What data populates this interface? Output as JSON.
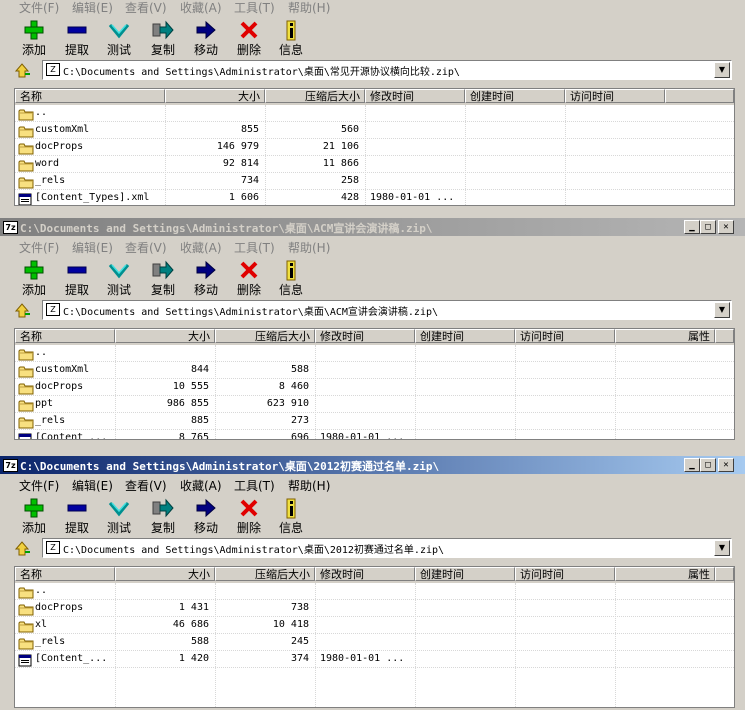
{
  "menu": [
    {
      "label": "文件(F)"
    },
    {
      "label": "编辑(E)"
    },
    {
      "label": "查看(V)"
    },
    {
      "label": "收藏(A)"
    },
    {
      "label": "工具(T)"
    },
    {
      "label": "帮助(H)"
    }
  ],
  "toolbar": [
    {
      "label": "添加",
      "icon": "add-icon"
    },
    {
      "label": "提取",
      "icon": "extract-icon"
    },
    {
      "label": "测试",
      "icon": "test-icon"
    },
    {
      "label": "复制",
      "icon": "copy-icon"
    },
    {
      "label": "移动",
      "icon": "move-icon"
    },
    {
      "label": "删除",
      "icon": "delete-icon"
    },
    {
      "label": "信息",
      "icon": "info-icon"
    }
  ],
  "colors": {
    "title_active": "#0a246a",
    "title_inactive": "#808080",
    "add": "#00c000",
    "extract": "#0000a0",
    "delete": "#e00000",
    "info": "#e0c000"
  },
  "windows": [
    {
      "title": "",
      "address": "C:\\Documents and Settings\\Administrator\\桌面\\常见开源协议横向比较.zip\\",
      "columns": [
        "名称",
        "大小",
        "压缩后大小",
        "修改时间",
        "创建时间",
        "访问时间"
      ],
      "files": [
        {
          "name": "..",
          "size": "",
          "packed": "",
          "modified": ""
        },
        {
          "name": "customXml",
          "size": "855",
          "packed": "560",
          "modified": ""
        },
        {
          "name": "docProps",
          "size": "146 979",
          "packed": "21 106",
          "modified": ""
        },
        {
          "name": "word",
          "size": "92 814",
          "packed": "11 866",
          "modified": ""
        },
        {
          "name": "_rels",
          "size": "734",
          "packed": "258",
          "modified": ""
        },
        {
          "name": "[Content_Types].xml",
          "size": "1 606",
          "packed": "428",
          "modified": "1980-01-01 ..."
        }
      ]
    },
    {
      "title": "C:\\Documents and Settings\\Administrator\\桌面\\ACM宣讲会演讲稿.zip\\",
      "address": "C:\\Documents and Settings\\Administrator\\桌面\\ACM宣讲会演讲稿.zip\\",
      "columns": [
        "名称",
        "大小",
        "压缩后大小",
        "修改时间",
        "创建时间",
        "访问时间",
        "属性"
      ],
      "files": [
        {
          "name": "..",
          "size": "",
          "packed": "",
          "modified": ""
        },
        {
          "name": "customXml",
          "size": "844",
          "packed": "588",
          "modified": ""
        },
        {
          "name": "docProps",
          "size": "10 555",
          "packed": "8 460",
          "modified": ""
        },
        {
          "name": "ppt",
          "size": "986 855",
          "packed": "623 910",
          "modified": ""
        },
        {
          "name": "_rels",
          "size": "885",
          "packed": "273",
          "modified": ""
        },
        {
          "name": "[Content_...",
          "size": "8 765",
          "packed": "696",
          "modified": "1980-01-01 ..."
        }
      ]
    },
    {
      "title": "C:\\Documents and Settings\\Administrator\\桌面\\2012初赛通过名单.zip\\",
      "address": "C:\\Documents and Settings\\Administrator\\桌面\\2012初赛通过名单.zip\\",
      "columns": [
        "名称",
        "大小",
        "压缩后大小",
        "修改时间",
        "创建时间",
        "访问时间",
        "属性"
      ],
      "files": [
        {
          "name": "..",
          "size": "",
          "packed": "",
          "modified": ""
        },
        {
          "name": "docProps",
          "size": "1 431",
          "packed": "738",
          "modified": ""
        },
        {
          "name": "xl",
          "size": "46 686",
          "packed": "10 418",
          "modified": ""
        },
        {
          "name": "_rels",
          "size": "588",
          "packed": "245",
          "modified": ""
        },
        {
          "name": "[Content_...",
          "size": "1 420",
          "packed": "374",
          "modified": "1980-01-01 ..."
        }
      ]
    }
  ]
}
